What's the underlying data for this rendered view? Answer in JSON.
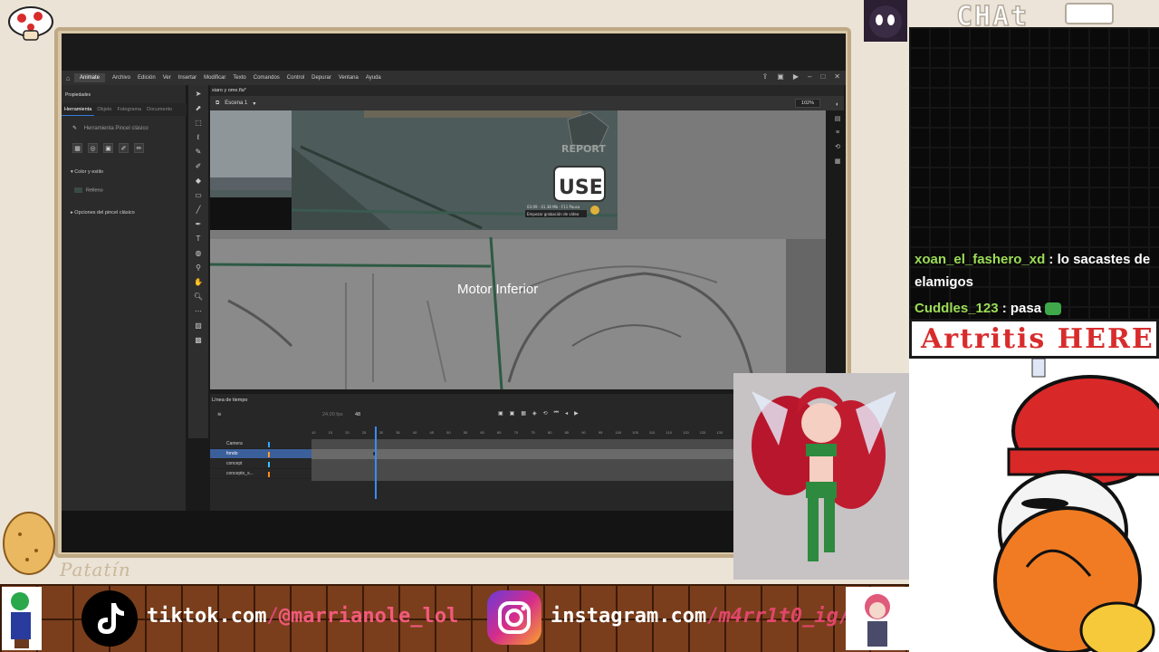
{
  "animate": {
    "app_name": "Animate",
    "menu": [
      "Archivo",
      "Edición",
      "Ver",
      "Insertar",
      "Modificar",
      "Texto",
      "Comandos",
      "Control",
      "Depurar",
      "Ventana",
      "Ayuda"
    ],
    "properties_title": "Propiedades",
    "properties_tabs": [
      "Herramienta",
      "Objeto",
      "Fotograma",
      "Documento"
    ],
    "tool_name": "Herramienta Pincel clásico",
    "color_section": "Color y estilo",
    "fill_label": "Relleno",
    "options_section": "Opciones del pincel clásico",
    "doc_tab": "xiaro y ome.fla*",
    "scene": "Escena 1",
    "zoom": "102%",
    "stage_label": "Motor Inferior",
    "stage_buttons": {
      "report": "REPORT",
      "use": "USE"
    },
    "recording_text": "Empezar grabación de vídeo",
    "recording_stats": "03:09 · 41.38 Mb · F11 Pausa",
    "timeline_title": "Línea de tiempo",
    "fps": "24,00 fps",
    "current_frame": "48",
    "ruler_marks": [
      "10",
      "15",
      "20",
      "25",
      "30",
      "35",
      "40",
      "45",
      "50",
      "55",
      "60",
      "65",
      "70",
      "75",
      "80",
      "85",
      "90",
      "95",
      "100",
      "105",
      "110",
      "115",
      "120",
      "125",
      "130"
    ],
    "layers": [
      {
        "name": "Camera",
        "color": "#34a5ff",
        "selected": false
      },
      {
        "name": "fondo",
        "color": "#ff9c2a",
        "selected": true
      },
      {
        "name": "concept",
        "color": "#34c4ff",
        "selected": false
      },
      {
        "name": "concepto_s...",
        "color": "#ff8a1a",
        "selected": false
      }
    ]
  },
  "chat": {
    "header": "CHAt",
    "messages": [
      {
        "user": "xoan_el_fashero_xd",
        "text": "lo sacastes de elamigos"
      },
      {
        "user": "Cuddles_123",
        "text": "pasa"
      }
    ]
  },
  "title_banner": "Artritis HERE",
  "signature": "Patatín",
  "socials": {
    "tiktok_prefix": "tiktok.com",
    "tiktok_handle": "@marrianole_lol",
    "instagram_prefix": "instagram.com",
    "instagram_handle": "m4rr1t0_ig"
  },
  "colors": {
    "frame_bg": "#ebe3d6",
    "chat_user": "#9bdc55",
    "banner_red": "#d82c2c",
    "brick_brown": "#7a3e1c"
  }
}
